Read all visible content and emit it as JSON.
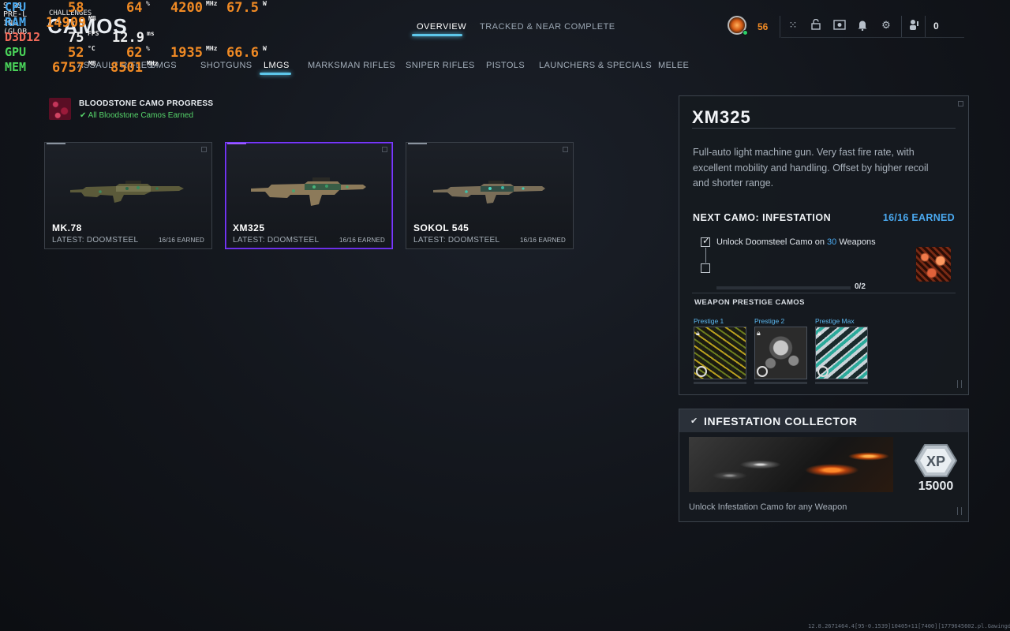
{
  "overlay": {
    "cpu": {
      "label": "CPU",
      "v1": "58",
      "v2": "64",
      "v3": "4200",
      "v4": "67.5"
    },
    "ram": {
      "label": "RAM",
      "v1": "14909"
    },
    "d3d": {
      "label": "D3D12",
      "v1": "75",
      "v2": "12.9"
    },
    "gpu": {
      "label": "GPU",
      "v1": "52",
      "v2": "62",
      "v3": "1935",
      "v4": "66.6"
    },
    "mem": {
      "label": "MEM",
      "v1": "6757",
      "v2": "8501"
    },
    "units": {
      "c": "°C",
      "pct": "%",
      "mhz": "MHz",
      "w": "W",
      "mb": "MB",
      "fps": "FPS",
      "ms": "ms"
    },
    "bg_text1": "S   RS PRE-L  ING (GLOB",
    "bg_text2": "CHALLENGES"
  },
  "page_title": "CAMOS",
  "top_tabs": [
    {
      "label": "OVERVIEW",
      "active": true
    },
    {
      "label": "TRACKED & NEAR COMPLETE",
      "active": false
    }
  ],
  "sub_tabs": [
    {
      "label": "ASSAULT RIFLES"
    },
    {
      "label": "SMGS"
    },
    {
      "label": "SHOTGUNS"
    },
    {
      "label": "LMGS"
    },
    {
      "label": "MARKSMAN RIFLES"
    },
    {
      "label": "SNIPER RIFLES"
    },
    {
      "label": "PISTOLS"
    },
    {
      "label": "LAUNCHERS & SPECIALS"
    },
    {
      "label": "MELEE"
    }
  ],
  "topright": {
    "level": "56",
    "count": "0"
  },
  "bloodstone": {
    "title": "BLOODSTONE CAMO PROGRESS",
    "status": "All Bloodstone Camos Earned"
  },
  "weapons": [
    {
      "name": "MK.78",
      "latest": "LATEST: DOOMSTEEL",
      "earned": "16/16 EARNED"
    },
    {
      "name": "XM325",
      "latest": "LATEST: DOOMSTEEL",
      "earned": "16/16 EARNED"
    },
    {
      "name": "SOKOL 545",
      "latest": "LATEST: DOOMSTEEL",
      "earned": "16/16 EARNED"
    }
  ],
  "detail": {
    "title": "XM325",
    "description": "Full-auto light machine gun. Very fast fire rate, with excellent mobility and handling. Offset by higher recoil and shorter range.",
    "next_camo": "NEXT CAMO: INFESTATION",
    "next_earned": "16/16 EARNED",
    "challenge_pre": "Unlock Doomsteel Camo on ",
    "challenge_num": "30",
    "challenge_post": " Weapons",
    "progress": "0/2",
    "prestige_title": "WEAPON PRESTIGE CAMOS",
    "prestige": [
      {
        "label": "Prestige 1"
      },
      {
        "label": "Prestige 2"
      },
      {
        "label": "Prestige Max"
      }
    ]
  },
  "collector": {
    "title": "INFESTATION COLLECTOR",
    "xp_label": "XP",
    "xp_value": "15000",
    "description": "Unlock Infestation Camo for any Weapon"
  },
  "build_string": "12.8.2671464.4[95-0.1539]10405+11[7400][1779645602.pl.Gawingdk]00012214831"
}
